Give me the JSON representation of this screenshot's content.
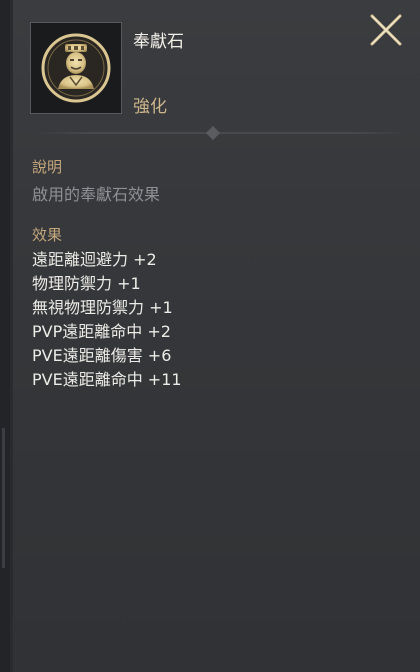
{
  "item": {
    "name": "奉獻石",
    "type": "強化",
    "icon": "warrior-portrait-medallion-icon"
  },
  "description": {
    "label": "說明",
    "text": "啟用的奉獻石效果"
  },
  "effects": {
    "label": "效果",
    "list": [
      "遠距離迴避力 +2",
      "物理防禦力 +1",
      "無視物理防禦力 +1",
      "PVP遠距離命中 +2",
      "PVE遠距離傷害 +6",
      "PVE遠距離命中 +11"
    ]
  },
  "colors": {
    "accent": "#c4a77c",
    "panel": "#36383b",
    "muted_text": "#8e9095"
  }
}
